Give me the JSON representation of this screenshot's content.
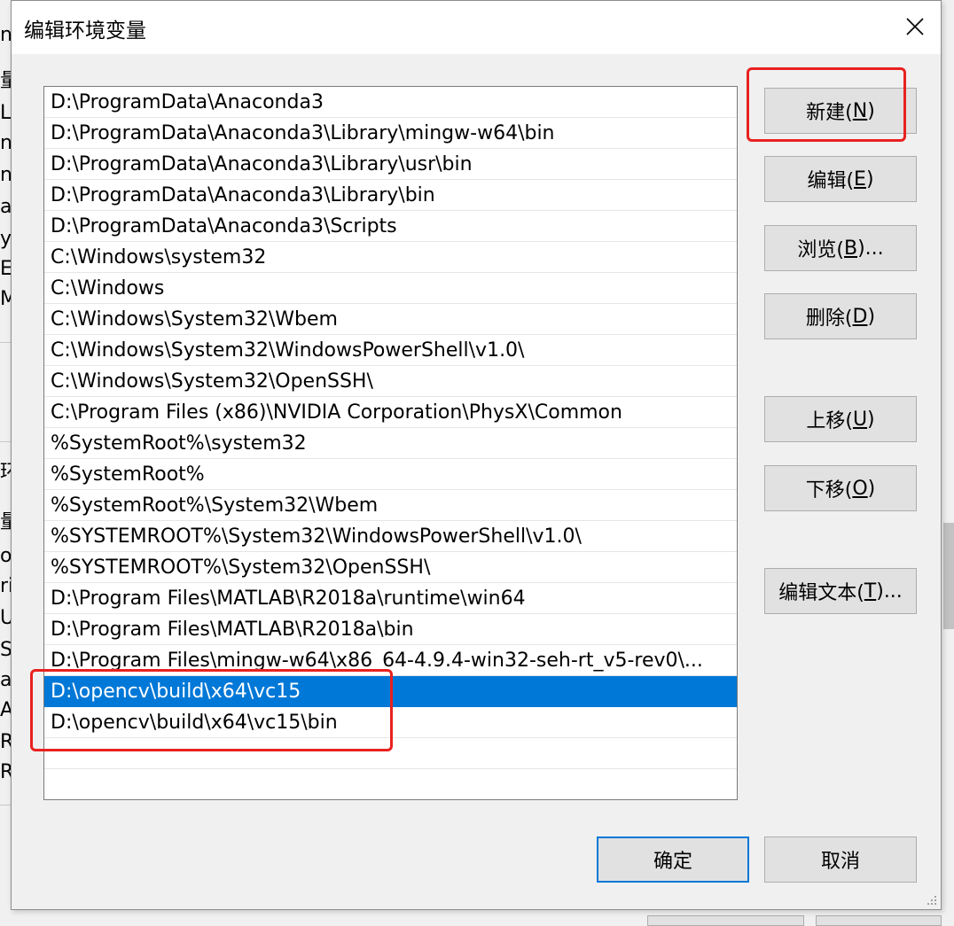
{
  "dialog": {
    "title": "编辑环境变量",
    "close_label": "✕"
  },
  "background_fragments": [
    "n",
    "量",
    "Li",
    "n",
    "n",
    "at",
    "y(",
    "EN",
    "M",
    "环",
    "量",
    "o",
    "ri",
    "U",
    "S",
    "at",
    "A",
    "R",
    "R"
  ],
  "path_list": {
    "items": [
      "D:\\ProgramData\\Anaconda3",
      "D:\\ProgramData\\Anaconda3\\Library\\mingw-w64\\bin",
      "D:\\ProgramData\\Anaconda3\\Library\\usr\\bin",
      "D:\\ProgramData\\Anaconda3\\Library\\bin",
      "D:\\ProgramData\\Anaconda3\\Scripts",
      "C:\\Windows\\system32",
      "C:\\Windows",
      "C:\\Windows\\System32\\Wbem",
      "C:\\Windows\\System32\\WindowsPowerShell\\v1.0\\",
      "C:\\Windows\\System32\\OpenSSH\\",
      "C:\\Program Files (x86)\\NVIDIA Corporation\\PhysX\\Common",
      "%SystemRoot%\\system32",
      "%SystemRoot%",
      "%SystemRoot%\\System32\\Wbem",
      "%SYSTEMROOT%\\System32\\WindowsPowerShell\\v1.0\\",
      "%SYSTEMROOT%\\System32\\OpenSSH\\",
      "D:\\Program Files\\MATLAB\\R2018a\\runtime\\win64",
      "D:\\Program Files\\MATLAB\\R2018a\\bin",
      "D:\\Program Files\\mingw-w64\\x86_64-4.9.4-win32-seh-rt_v5-rev0\\...",
      "D:\\opencv\\build\\x64\\vc15",
      "D:\\opencv\\build\\x64\\vc15\\bin"
    ],
    "selected_index": 19
  },
  "buttons": {
    "new": {
      "text": "新建(",
      "key": "N",
      "close": ")"
    },
    "edit": {
      "text": "编辑(",
      "key": "E",
      "close": ")"
    },
    "browse": {
      "text": "浏览(",
      "key": "B",
      "close": ")..."
    },
    "delete": {
      "text": "删除(",
      "key": "D",
      "close": ")"
    },
    "move_up": {
      "text": "上移(",
      "key": "U",
      "close": ")"
    },
    "move_down": {
      "text": "下移(",
      "key": "O",
      "close": ")"
    },
    "edit_text": {
      "text": "编辑文本(",
      "key": "T",
      "close": ")..."
    },
    "ok": "确定",
    "cancel": "取消"
  },
  "colors": {
    "selection": "#0078d7",
    "annotation": "#e8211f"
  }
}
